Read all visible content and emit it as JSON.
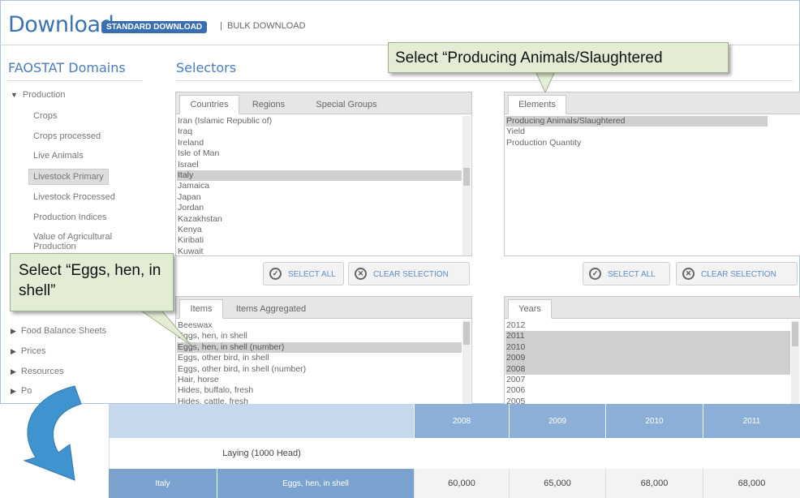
{
  "header": {
    "title": "Download",
    "standard_label": "STANDARD DOWNLOAD",
    "separator": "|",
    "bulk_label": "BULK DOWNLOAD"
  },
  "sidebar": {
    "title": "FAOSTAT Domains",
    "production_label": "Production",
    "sub_items": [
      "Crops",
      "Crops processed",
      "Live Animals",
      "Livestock Primary",
      "Livestock Processed",
      "Production Indices",
      "Value of Agricultural Production"
    ],
    "groups": [
      "Food Balance Sheets",
      "Prices",
      "Resources",
      "Po"
    ]
  },
  "selectors": {
    "title": "Selectors",
    "countries_panel": {
      "tabs": [
        "Countries",
        "Regions",
        "Special Groups"
      ],
      "items": [
        "Iran (Islamic Republic of)",
        "Iraq",
        "Ireland",
        "Isle of Man",
        "Israel",
        "Italy",
        "Jamaica",
        "Japan",
        "Jordan",
        "Kazakhstan",
        "Kenya",
        "Kiribati",
        "Kuwait"
      ],
      "selected": "Italy"
    },
    "elements_panel": {
      "tabs": [
        "Elements"
      ],
      "items": [
        "Producing Animals/Slaughtered",
        "Yield",
        "Production Quantity"
      ],
      "selected": "Producing Animals/Slaughtered"
    },
    "items_panel": {
      "tabs": [
        "Items",
        "Items Aggregated"
      ],
      "items": [
        "Beeswax",
        "Eggs, hen, in shell",
        "Eggs, hen, in shell (number)",
        "Eggs, other bird, in shell",
        "Eggs, other bird, in shell (number)",
        "Hair, horse",
        "Hides, buffalo, fresh",
        "Hides, cattle, fresh"
      ],
      "selected": "Eggs, hen, in shell (number)"
    },
    "years_panel": {
      "tabs": [
        "Years"
      ],
      "items": [
        "2012",
        "2011",
        "2010",
        "2009",
        "2008",
        "2007",
        "2006",
        "2005"
      ],
      "selected": [
        "2011",
        "2010",
        "2009",
        "2008"
      ]
    },
    "select_all_label": "SELECT ALL",
    "clear_selection_label": "CLEAR SELECTION"
  },
  "callouts": {
    "elements": "Select  “Producing Animals/Slaughtered",
    "items": "Select  “Eggs, hen, in shell”"
  },
  "result_table": {
    "years": [
      "2008",
      "2009",
      "2010",
      "2011"
    ],
    "group_label": "Laying (1000 Head)",
    "row": {
      "country": "Italy",
      "item": "Eggs, hen, in shell",
      "values": [
        "60,000",
        "65,000",
        "68,000",
        "68,000"
      ]
    }
  },
  "colors": {
    "accent": "#3a6eb2",
    "callout_bg": "#e3ecd4",
    "table_header": "#8bafd6",
    "table_row": "#7aa2cf",
    "arrow": "#3f93cf"
  }
}
